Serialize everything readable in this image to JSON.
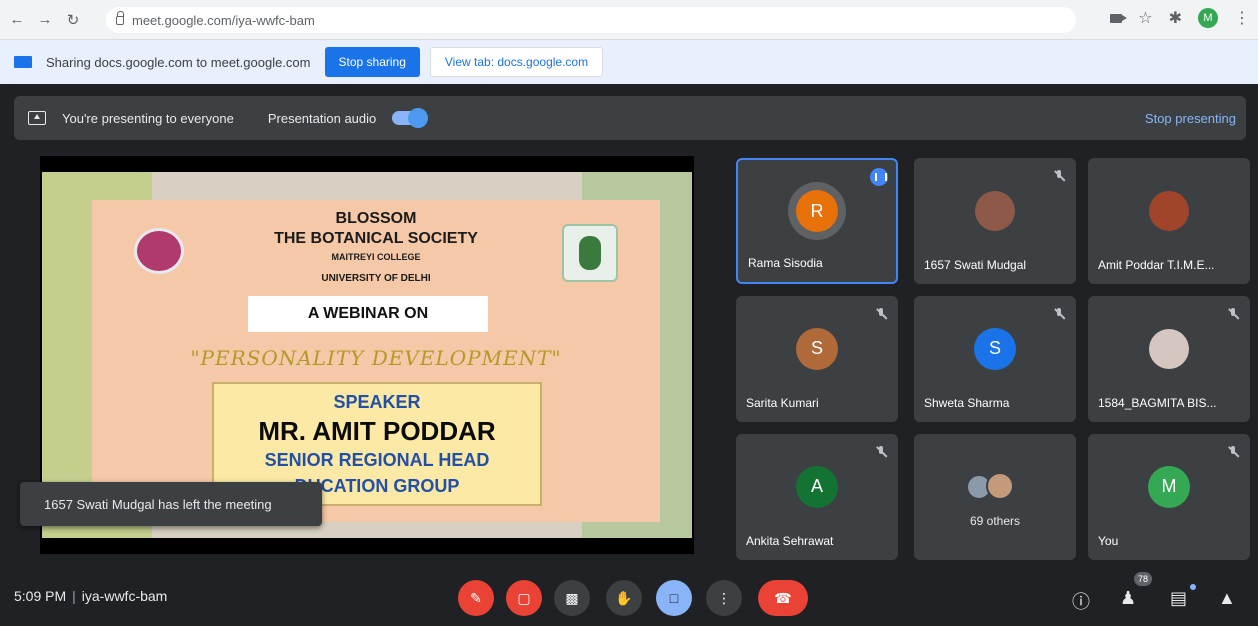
{
  "browser": {
    "url": "meet.google.com/iya-wwfc-bam",
    "profile_initial": "M"
  },
  "sharebar": {
    "text": "Sharing docs.google.com to meet.google.com",
    "stop_label": "Stop sharing",
    "view_label": "View tab: docs.google.com"
  },
  "banner": {
    "presenting_text": "You're presenting to everyone",
    "audio_label": "Presentation audio",
    "stop_label": "Stop presenting"
  },
  "slide": {
    "title1": "BLOSSOM",
    "title2": "THE BOTANICAL SOCIETY",
    "college": "MAITREYI COLLEGE",
    "university": "UNIVERSITY OF DELHI",
    "webinar": "A WEBINAR ON",
    "topic": "\"PERSONALITY DEVELOPMENT\"",
    "speaker_label": "SPEAKER",
    "speaker_name": "MR. AMIT PODDAR",
    "role": "SENIOR REGIONAL HEAD",
    "org": "DUCATION GROUP"
  },
  "toast": {
    "text": "1657 Swati Mudgal has left the meeting"
  },
  "tiles": [
    {
      "name": "Rama Sisodia",
      "initial": "R",
      "color": "#e8710a"
    },
    {
      "name": "1657 Swati Mudgal",
      "initial": "",
      "color": "#8d5a4a"
    },
    {
      "name": "Amit Poddar T.I.M.E...",
      "initial": "",
      "color": "#a0452a"
    },
    {
      "name": "Sarita Kumari",
      "initial": "S",
      "color": "#b06a3a"
    },
    {
      "name": "Shweta Sharma",
      "initial": "S",
      "color": "#1a73e8"
    },
    {
      "name": "1584_BAGMITA BIS...",
      "initial": "",
      "color": "#d6c6c0"
    },
    {
      "name": "Ankita Sehrawat",
      "initial": "A",
      "color": "#137333"
    },
    {
      "name": "69 others",
      "initial": "",
      "color": ""
    },
    {
      "name": "You",
      "initial": "M",
      "color": "#34a853"
    }
  ],
  "bottom": {
    "time": "5:09 PM",
    "meeting_code": "iya-wwfc-bam",
    "participants_count": "78"
  }
}
